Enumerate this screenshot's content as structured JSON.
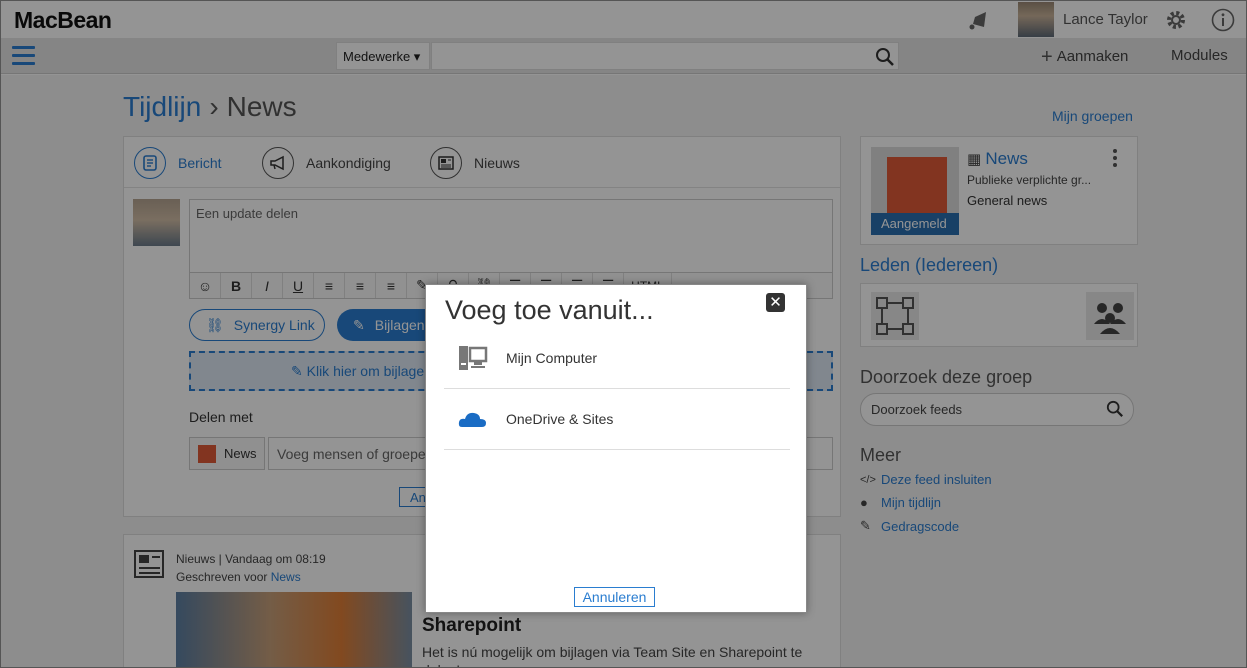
{
  "app": {
    "logo": "MacBean"
  },
  "user": {
    "name": "Lance Taylor"
  },
  "search": {
    "scope": "Medewerke ▾",
    "placeholder": ""
  },
  "navbar": {
    "create_label": "Aanmaken",
    "modules_label": "Modules"
  },
  "breadcrumb": {
    "root": "Tijdlijn",
    "current": "News"
  },
  "sidebar_links": {
    "mijn_groepen": "Mijn groepen"
  },
  "composer": {
    "tabs": [
      {
        "label": "Bericht",
        "icon": "message-icon",
        "active": true
      },
      {
        "label": "Aankondiging",
        "icon": "megaphone-icon",
        "active": false
      },
      {
        "label": "Nieuws",
        "icon": "newspaper-icon",
        "active": false
      }
    ],
    "placeholder": "Een update delen",
    "toolbar": [
      "☺",
      "B",
      "I",
      "U",
      "≡",
      "≡",
      "≡",
      "✎",
      "⚲",
      "⛓",
      "☰",
      "☰",
      "☰",
      "☰",
      "HTML"
    ],
    "synergy_link_label": "Synergy Link",
    "attachments_label": "Bijlagen",
    "dropzone_text": "Klik hier om bijlagen",
    "share_label": "Delen met",
    "share_tag": "News",
    "share_placeholder": "Voeg mensen of groepen",
    "post_button": "An"
  },
  "feed": {
    "meta_line": "Nieuws | Vandaag om 08:19",
    "written_for_prefix": "Geschreven voor ",
    "written_for_link": "News",
    "title": "Sharepoint",
    "text": "Het is nú mogelijk om bijlagen via Team Site en Sharepoint te delen!"
  },
  "group": {
    "name": "News",
    "description": "Publieke verplichte gr...",
    "type": "General news",
    "badge": "Aangemeld"
  },
  "members": {
    "title": "Leden (Iedereen)"
  },
  "group_search": {
    "title": "Doorzoek deze groep",
    "placeholder": "Doorzoek feeds"
  },
  "more": {
    "title": "Meer",
    "links": [
      {
        "label": "Deze feed insluiten",
        "icon": "code-icon"
      },
      {
        "label": "Mijn tijdlijn",
        "icon": "person-icon"
      },
      {
        "label": "Gedragscode",
        "icon": "conduct-icon"
      }
    ]
  },
  "modal": {
    "title": "Voeg toe vanuit...",
    "items": [
      {
        "label": "Mijn Computer",
        "icon": "computer-icon"
      },
      {
        "label": "OneDrive & Sites",
        "icon": "onedrive-cloud-icon"
      }
    ],
    "cancel_label": "Annuleren",
    "close_glyph": "✕"
  },
  "colors": {
    "accent": "#2a7dd0",
    "brand_orange": "#e05b38",
    "overlay": "rgba(0,0,0,0.42)"
  }
}
